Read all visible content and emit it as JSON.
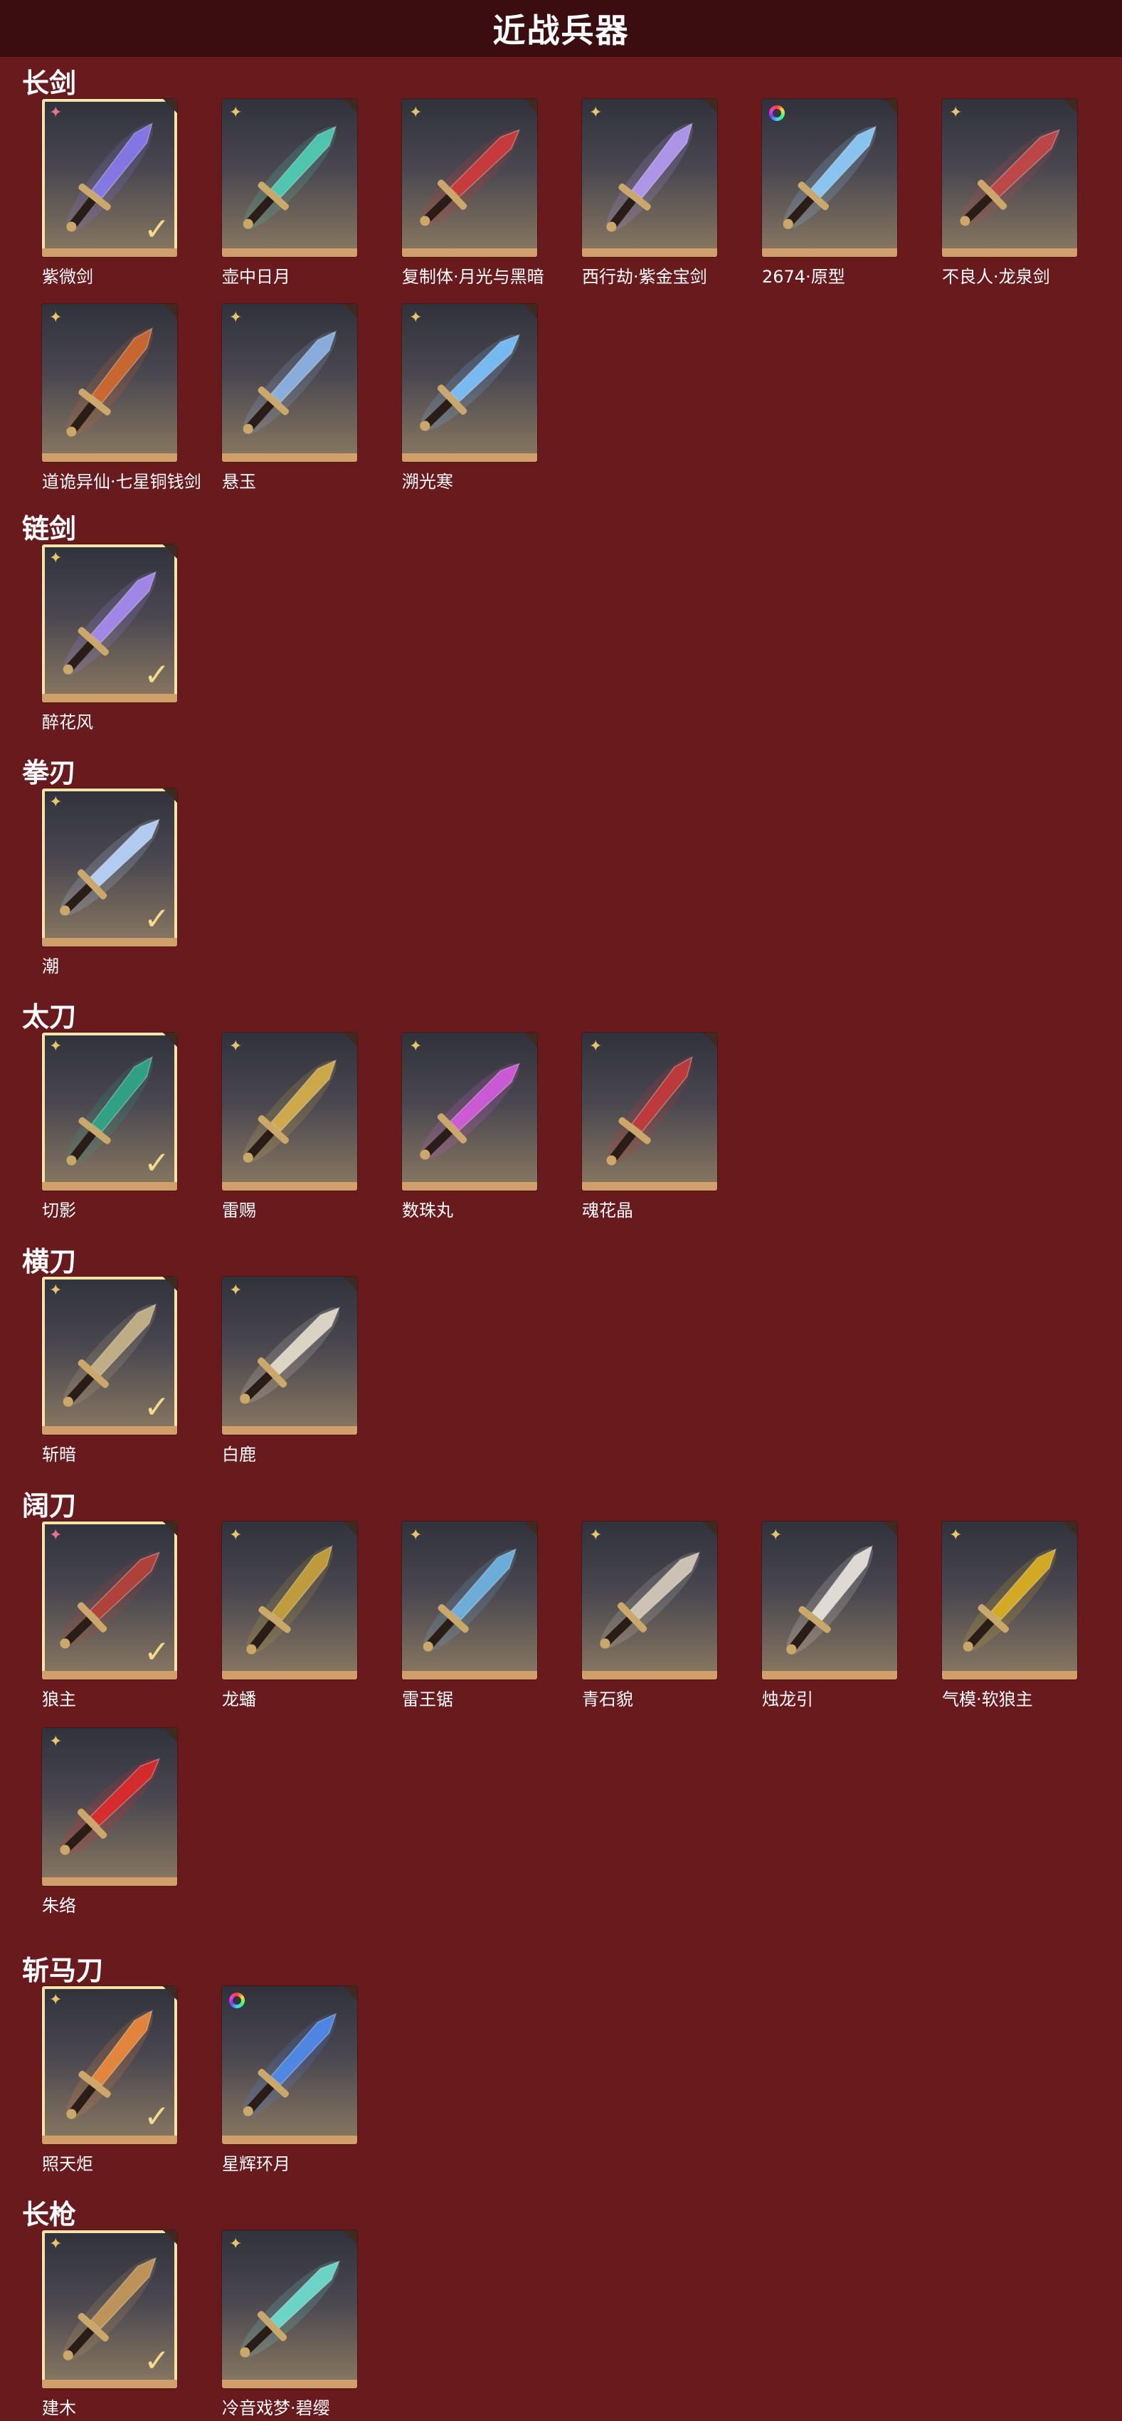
{
  "page": {
    "title": "近战兵器"
  },
  "sections": [
    {
      "title": "长剑",
      "items": [
        {
          "name": "紫微剑",
          "rarity": "pink",
          "selected": true,
          "color": "#8a7cf0"
        },
        {
          "name": "壶中日月",
          "rarity": "gold",
          "selected": false,
          "color": "#4fd1b8"
        },
        {
          "name": "复制体·月光与黑暗",
          "rarity": "gold",
          "selected": false,
          "color": "#d23a3a"
        },
        {
          "name": "西行劫·紫金宝剑",
          "rarity": "gold",
          "selected": false,
          "color": "#b79cf4"
        },
        {
          "name": "2674·原型",
          "rarity": "rainbow",
          "selected": false,
          "color": "#8fd0ff"
        },
        {
          "name": "不良人·龙泉剑",
          "rarity": "gold",
          "selected": false,
          "color": "#c64848"
        },
        {
          "name": "道诡异仙·七星铜钱剑",
          "rarity": "gold",
          "selected": false,
          "color": "#d46a2e"
        },
        {
          "name": "悬玉",
          "rarity": "gold",
          "selected": false,
          "color": "#8eb6e8"
        },
        {
          "name": "溯光寒",
          "rarity": "gold",
          "selected": false,
          "color": "#7cc4ff"
        }
      ]
    },
    {
      "title": "链剑",
      "items": [
        {
          "name": "醉花风",
          "rarity": "gold",
          "selected": true,
          "color": "#a98cf5"
        }
      ]
    },
    {
      "title": "拳刃",
      "items": [
        {
          "name": "潮",
          "rarity": "gold",
          "selected": true,
          "color": "#bcd8ff"
        }
      ]
    },
    {
      "title": "太刀",
      "items": [
        {
          "name": "切影",
          "rarity": "gold",
          "selected": true,
          "color": "#2fa98a"
        },
        {
          "name": "雷赐",
          "rarity": "gold",
          "selected": false,
          "color": "#d9b24a"
        },
        {
          "name": "数珠丸",
          "rarity": "gold",
          "selected": false,
          "color": "#d65ce0"
        },
        {
          "name": "魂花晶",
          "rarity": "gold",
          "selected": false,
          "color": "#c73a3a"
        }
      ]
    },
    {
      "title": "横刀",
      "items": [
        {
          "name": "斩暗",
          "rarity": "gold",
          "selected": true,
          "color": "#c9b68a"
        },
        {
          "name": "白鹿",
          "rarity": "gold",
          "selected": false,
          "color": "#e8e0cf"
        }
      ]
    },
    {
      "title": "阔刀",
      "items": [
        {
          "name": "狼主",
          "rarity": "pink",
          "selected": true,
          "color": "#b8433a"
        },
        {
          "name": "龙蟠",
          "rarity": "gold",
          "selected": false,
          "color": "#c9a43a"
        },
        {
          "name": "雷王锯",
          "rarity": "gold",
          "selected": false,
          "color": "#6fb6e6"
        },
        {
          "name": "青石貌",
          "rarity": "gold",
          "selected": false,
          "color": "#d8cdbd"
        },
        {
          "name": "烛龙引",
          "rarity": "gold",
          "selected": false,
          "color": "#ece7e0"
        },
        {
          "name": "气模·软狼主",
          "rarity": "gold",
          "selected": false,
          "color": "#e0b21f"
        },
        {
          "name": "朱络",
          "rarity": "gold",
          "selected": false,
          "color": "#e22a2a"
        }
      ]
    },
    {
      "title": "斩马刀",
      "items": [
        {
          "name": "照天炬",
          "rarity": "gold",
          "selected": true,
          "color": "#f08a3a"
        },
        {
          "name": "星辉环月",
          "rarity": "rainbow",
          "selected": false,
          "color": "#4f8df0"
        }
      ]
    },
    {
      "title": "长枪",
      "items": [
        {
          "name": "建木",
          "rarity": "gold",
          "selected": true,
          "color": "#c89a5a"
        },
        {
          "name": "冷音戏梦·碧缨",
          "rarity": "gold",
          "selected": false,
          "color": "#6fe0d2"
        }
      ]
    }
  ]
}
